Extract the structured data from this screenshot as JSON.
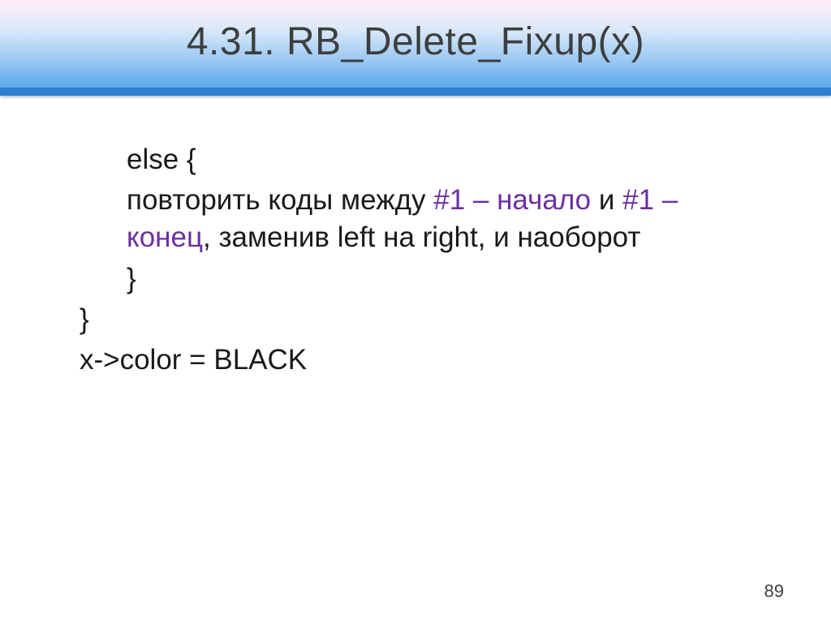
{
  "title": "4.31. RB_Delete_Fixup(x)",
  "code": {
    "line1": "else {",
    "line2_a": " повторить коды между ",
    "line2_purple1": "#1 – начало",
    "line2_b": " и ",
    "line2_purple2": "#1 – конец",
    "line2_c": ", заменив left на right, и наоборот",
    "line3": "}",
    "line4": "}",
    "line5": "x->color = BLACK"
  },
  "page_number": "89"
}
